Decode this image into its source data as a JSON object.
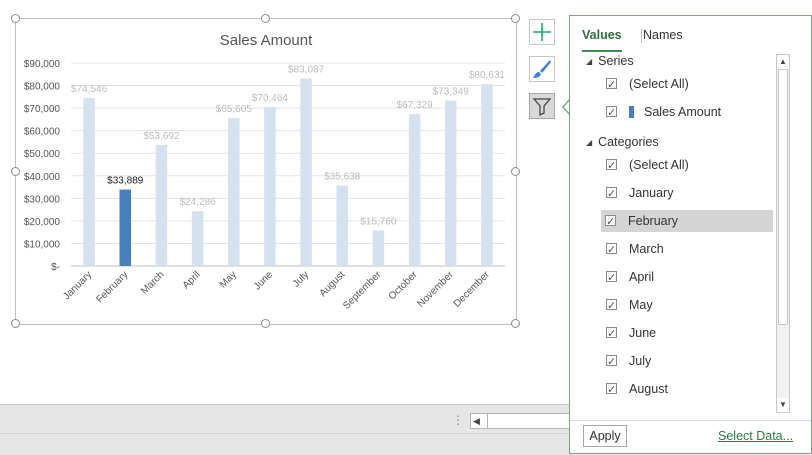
{
  "chart_data": {
    "type": "bar",
    "title": "Sales Amount",
    "categories": [
      "January",
      "February",
      "March",
      "April",
      "May",
      "June",
      "July",
      "August",
      "September",
      "October",
      "November",
      "December"
    ],
    "series": [
      {
        "name": "Sales Amount",
        "values": [
          74546,
          33889,
          53692,
          24286,
          65605,
          70464,
          83087,
          35638,
          15760,
          67329,
          73349,
          80631
        ]
      }
    ],
    "data_labels": [
      "$74,546",
      "$33,889",
      "$53,692",
      "$24,286",
      "$65,605",
      "$70,464",
      "$83,087",
      "$35,638",
      "$15,760",
      "$67,329",
      "$73,349",
      "$80,631"
    ],
    "highlighted_category": "February",
    "y_ticks": [
      "$-",
      "$10,000",
      "$20,000",
      "$30,000",
      "$40,000",
      "$50,000",
      "$60,000",
      "$70,000",
      "$80,000",
      "$90,000"
    ],
    "ylim": [
      0,
      90000
    ],
    "grid": true,
    "legend": "none",
    "colors": {
      "highlight": "#4a7ebb",
      "dimmed": "#d6e1f0",
      "label_dim": "#bcbcbc",
      "label_highlight": "#222222"
    }
  },
  "filter_panel": {
    "tabs": [
      {
        "label": "Values",
        "active": true
      },
      {
        "label": "Names",
        "active": false
      }
    ],
    "series_header": "Series",
    "series_items": [
      "(Select All)",
      "Sales Amount"
    ],
    "categories_header": "Categories",
    "category_items": [
      "(Select All)",
      "January",
      "February",
      "March",
      "April",
      "May",
      "June",
      "July",
      "August"
    ],
    "selected_item": "February",
    "apply_label": "Apply",
    "select_data_label": "Select Data..."
  },
  "side_buttons": [
    {
      "icon": "plus-icon",
      "active": false
    },
    {
      "icon": "brush-icon",
      "active": false
    },
    {
      "icon": "filter-icon",
      "active": true
    }
  ],
  "colors": {
    "accent_green": "#3f8a4e",
    "panel_border": "#79a883",
    "plus_green": "#21a366",
    "brush_blue": "#3b7dd8"
  }
}
